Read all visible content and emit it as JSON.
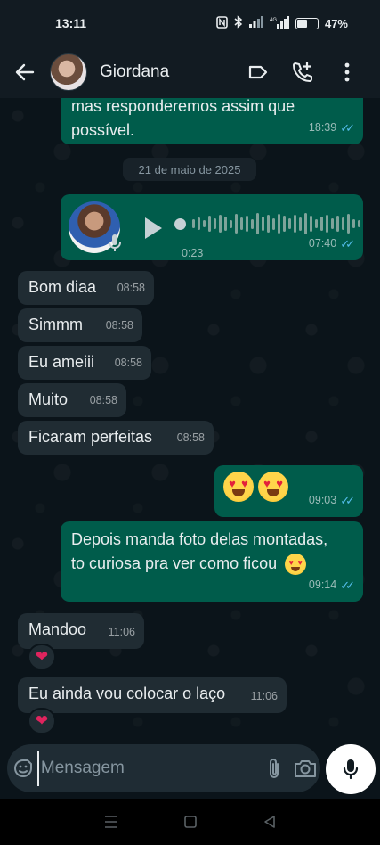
{
  "status_bar": {
    "time": "13:11",
    "signal": "⁴⁶",
    "battery": "47%",
    "battery_level": 0.47
  },
  "header": {
    "contact_name": "Giordana",
    "icons": [
      "back-arrow-icon",
      "label-icon",
      "add-call-icon",
      "more-vert-icon"
    ]
  },
  "messages": {
    "partial": {
      "text": "mas responderemos assim que\npossível.",
      "time": "18:39"
    },
    "date_separator": "21 de maio de 2025",
    "voice": {
      "duration": "0:23",
      "time": "07:40",
      "progress": 0
    },
    "in1": {
      "text": "Bom diaa",
      "time": "08:58"
    },
    "in2": {
      "text": "Simmm",
      "time": "08:58"
    },
    "in3": {
      "text": "Eu ameiii",
      "time": "08:58"
    },
    "in4": {
      "text": "Muito",
      "time": "08:58"
    },
    "in5": {
      "text": "Ficaram perfeitas",
      "time": "08:58"
    },
    "out_emoji": {
      "emoji_count": 2,
      "time": "09:03"
    },
    "out_text": {
      "line1": "Depois manda foto delas montadas,",
      "line2": "to curiosa pra ver como ficou",
      "time": "09:14"
    },
    "in6": {
      "text": "Mandoo",
      "time": "11:06",
      "reaction": "❤"
    },
    "in7": {
      "text": "Eu ainda vou colocar o laço",
      "time": "11:06",
      "reaction": "❤"
    }
  },
  "composer": {
    "placeholder": "Mensagem",
    "value": ""
  },
  "colors": {
    "outgoing": "#005c4b",
    "incoming": "#202c33",
    "read_ticks": "#53bdeb",
    "background": "#0b141a"
  }
}
